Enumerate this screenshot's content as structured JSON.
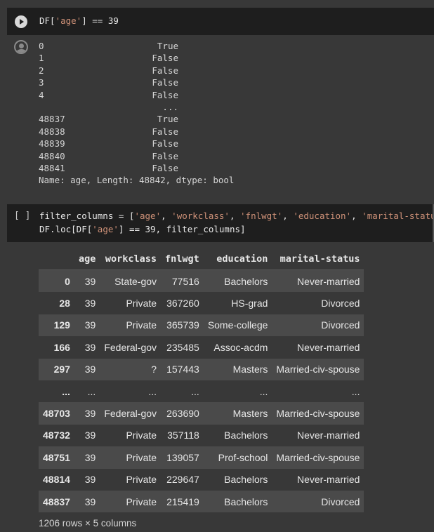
{
  "cell1": {
    "code_prefix": "DF[",
    "code_string": "'age'",
    "code_suffix": "] == 39",
    "output_rows": [
      {
        "index": "0",
        "value": "True"
      },
      {
        "index": "1",
        "value": "False"
      },
      {
        "index": "2",
        "value": "False"
      },
      {
        "index": "3",
        "value": "False"
      },
      {
        "index": "4",
        "value": "False"
      },
      {
        "index": "",
        "value": "..."
      },
      {
        "index": "48837",
        "value": "True"
      },
      {
        "index": "48838",
        "value": "False"
      },
      {
        "index": "48839",
        "value": "False"
      },
      {
        "index": "48840",
        "value": "False"
      },
      {
        "index": "48841",
        "value": "False"
      }
    ],
    "output_footer": "Name: age, Length: 48842, dtype: bool"
  },
  "cell2": {
    "exec_bracket": "[ ]",
    "line1_prefix": "filter_columns = [",
    "line1_s1": "'age'",
    "line1_s2": "'workclass'",
    "line1_s3": "'fnlwgt'",
    "line1_s4": "'education'",
    "line1_s5": "'marital-status'",
    "line1_suffix": "]",
    "line2_prefix": "DF.loc[DF[",
    "line2_string": "'age'",
    "line2_suffix": "] == 39, filter_columns]"
  },
  "dataframe": {
    "columns": [
      "age",
      "workclass",
      "fnlwgt",
      "education",
      "marital-status"
    ],
    "rows": [
      [
        "0",
        "39",
        "State-gov",
        "77516",
        "Bachelors",
        "Never-married"
      ],
      [
        "28",
        "39",
        "Private",
        "367260",
        "HS-grad",
        "Divorced"
      ],
      [
        "129",
        "39",
        "Private",
        "365739",
        "Some-college",
        "Divorced"
      ],
      [
        "166",
        "39",
        "Federal-gov",
        "235485",
        "Assoc-acdm",
        "Never-married"
      ],
      [
        "297",
        "39",
        "?",
        "157443",
        "Masters",
        "Married-civ-spouse"
      ],
      [
        "...",
        "...",
        "...",
        "...",
        "...",
        "..."
      ],
      [
        "48703",
        "39",
        "Federal-gov",
        "263690",
        "Masters",
        "Married-civ-spouse"
      ],
      [
        "48732",
        "39",
        "Private",
        "357118",
        "Bachelors",
        "Never-married"
      ],
      [
        "48751",
        "39",
        "Private",
        "139057",
        "Prof-school",
        "Married-civ-spouse"
      ],
      [
        "48814",
        "39",
        "Private",
        "229647",
        "Bachelors",
        "Never-married"
      ],
      [
        "48837",
        "39",
        "Private",
        "215419",
        "Bachelors",
        "Divorced"
      ]
    ],
    "dimensions": "1206 rows × 5 columns"
  },
  "colors": {
    "string": "#ce9178",
    "cell_bg": "#1e1e1e",
    "page_bg": "#383838"
  },
  "icons": {
    "run": "play-circle-icon",
    "output": "user-avatar-icon"
  }
}
